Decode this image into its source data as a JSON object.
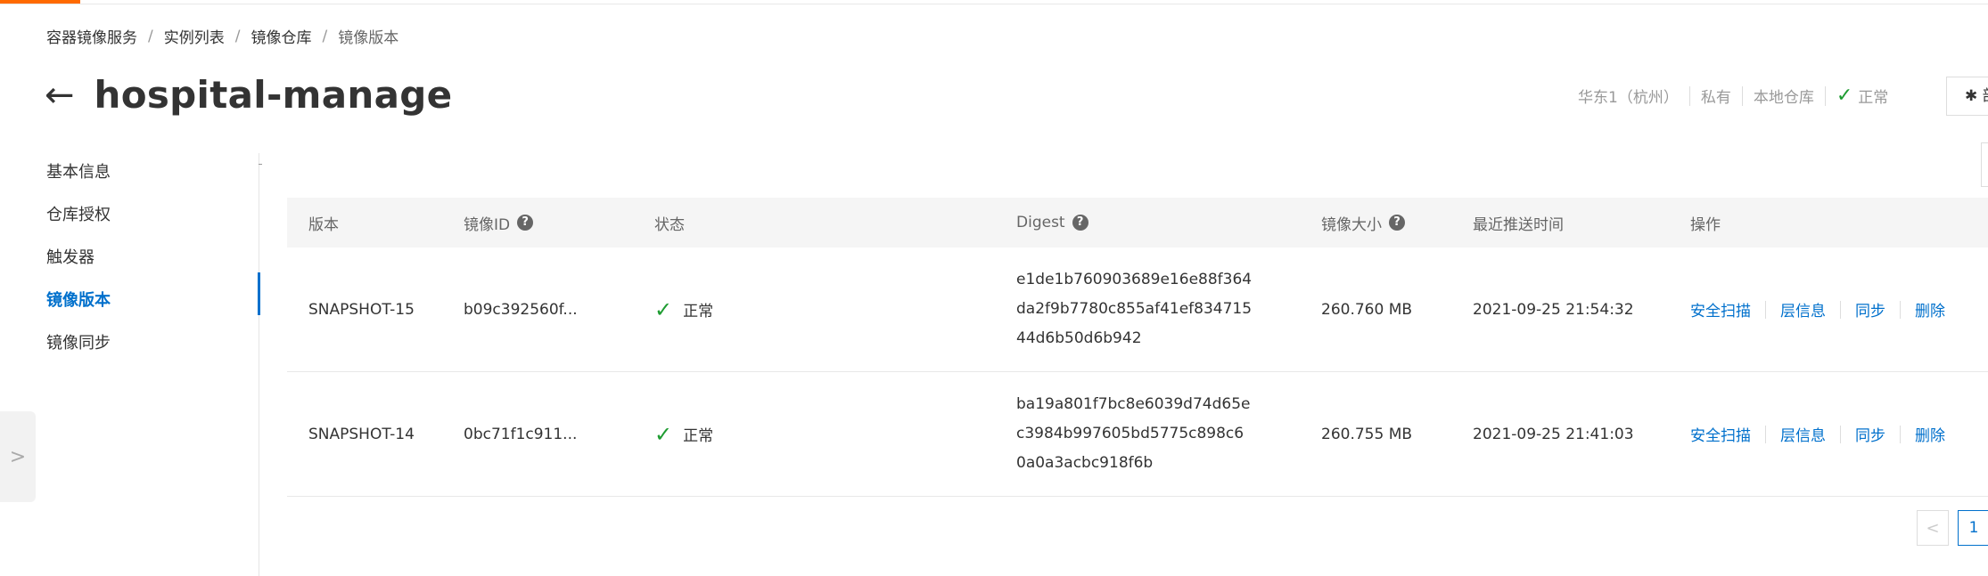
{
  "breadcrumb": [
    "容器镜像服务",
    "实例列表",
    "镜像仓库",
    "镜像版本"
  ],
  "breadcrumb_sep": "/",
  "header": {
    "back_icon": "←",
    "title": "hospital-manage",
    "region": "华东1（杭州）",
    "visibility": "私有",
    "repo_type": "本地仓库",
    "status": "正常",
    "status_icon": "✓",
    "action_button": "✱ 部"
  },
  "sidebar": {
    "items": [
      {
        "label": "基本信息",
        "active": false
      },
      {
        "label": "仓库授权",
        "active": false
      },
      {
        "label": "触发器",
        "active": false
      },
      {
        "label": "镜像版本",
        "active": true
      },
      {
        "label": "镜像同步",
        "active": false
      }
    ],
    "expand_icon": ">"
  },
  "table": {
    "headers": {
      "version": "版本",
      "image_id": "镜像ID",
      "status": "状态",
      "digest": "Digest",
      "size": "镜像大小",
      "push_time": "最近推送时间",
      "ops": "操作"
    },
    "help_icon": "?",
    "rows": [
      {
        "version": "SNAPSHOT-15",
        "image_id": "b09c392560f...",
        "status": "正常",
        "digest": [
          "e1de1b760903689e16e88f364",
          "da2f9b7780c855af41ef834715",
          "44d6b50d6b942"
        ],
        "size": "260.760 MB",
        "push_time": "2021-09-25 21:54:32",
        "ops": [
          "安全扫描",
          "层信息",
          "同步",
          "删除"
        ]
      },
      {
        "version": "SNAPSHOT-14",
        "image_id": "0bc71f1c911...",
        "status": "正常",
        "digest": [
          "ba19a801f7bc8e6039d74d65e",
          "c3984b997605bd5775c898c6",
          "0a0a3acbc918f6b"
        ],
        "size": "260.755 MB",
        "push_time": "2021-09-25 21:41:03",
        "ops": [
          "安全扫描",
          "层信息",
          "同步",
          "删除"
        ]
      }
    ]
  },
  "pagination": {
    "prev_icon": "<",
    "current_page": "1"
  },
  "colors": {
    "accent": "#ff6a00",
    "link": "#0070cc",
    "success": "#1e9c31"
  }
}
